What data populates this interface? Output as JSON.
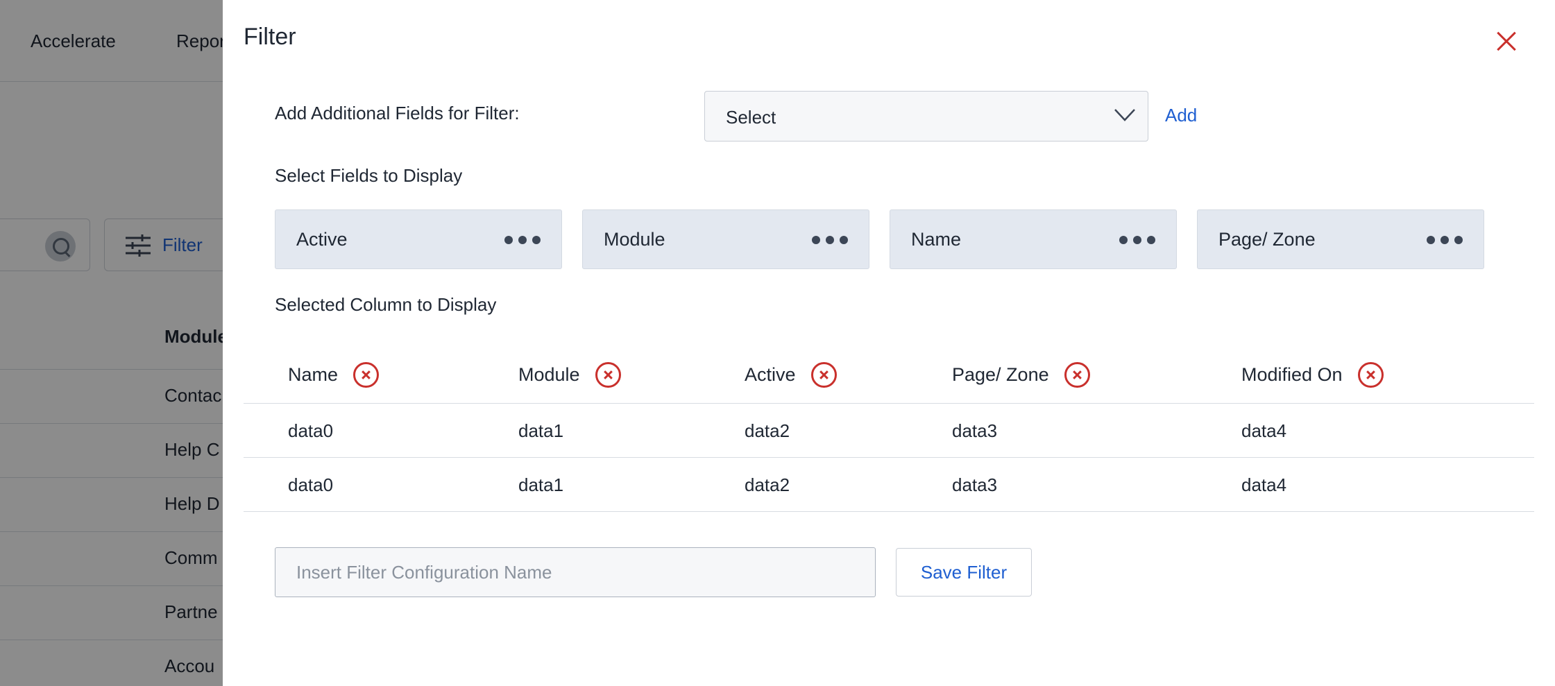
{
  "background": {
    "nav": [
      "Accelerate",
      "Repor"
    ],
    "filter_label": "Filter",
    "column_header": "Module",
    "rows": [
      "Contac",
      "Help C",
      "Help D",
      "Comm",
      "Partne",
      "Accou"
    ]
  },
  "modal": {
    "title": "Filter",
    "add_fields_label": "Add Additional Fields for Filter:",
    "select_value": "Select",
    "add_link": "Add",
    "select_fields_label": "Select Fields to Display",
    "fields": [
      "Active",
      "Module",
      "Name",
      "Page/ Zone"
    ],
    "selected_columns_label": "Selected Column to Display",
    "columns": [
      "Name",
      "Module",
      "Active",
      "Page/ Zone",
      "Modified On"
    ],
    "rows": [
      [
        "data0",
        "data1",
        "data2",
        "data3",
        "data4"
      ],
      [
        "data0",
        "data1",
        "data2",
        "data3",
        "data4"
      ]
    ],
    "config_name_placeholder": "Insert Filter Configuration Name",
    "save_button": "Save Filter"
  },
  "colors": {
    "accent": "#1f5fd1",
    "danger": "#c9302c",
    "chip_bg": "#e3e8f0",
    "overlay": "rgba(0,0,0,0.45)"
  }
}
